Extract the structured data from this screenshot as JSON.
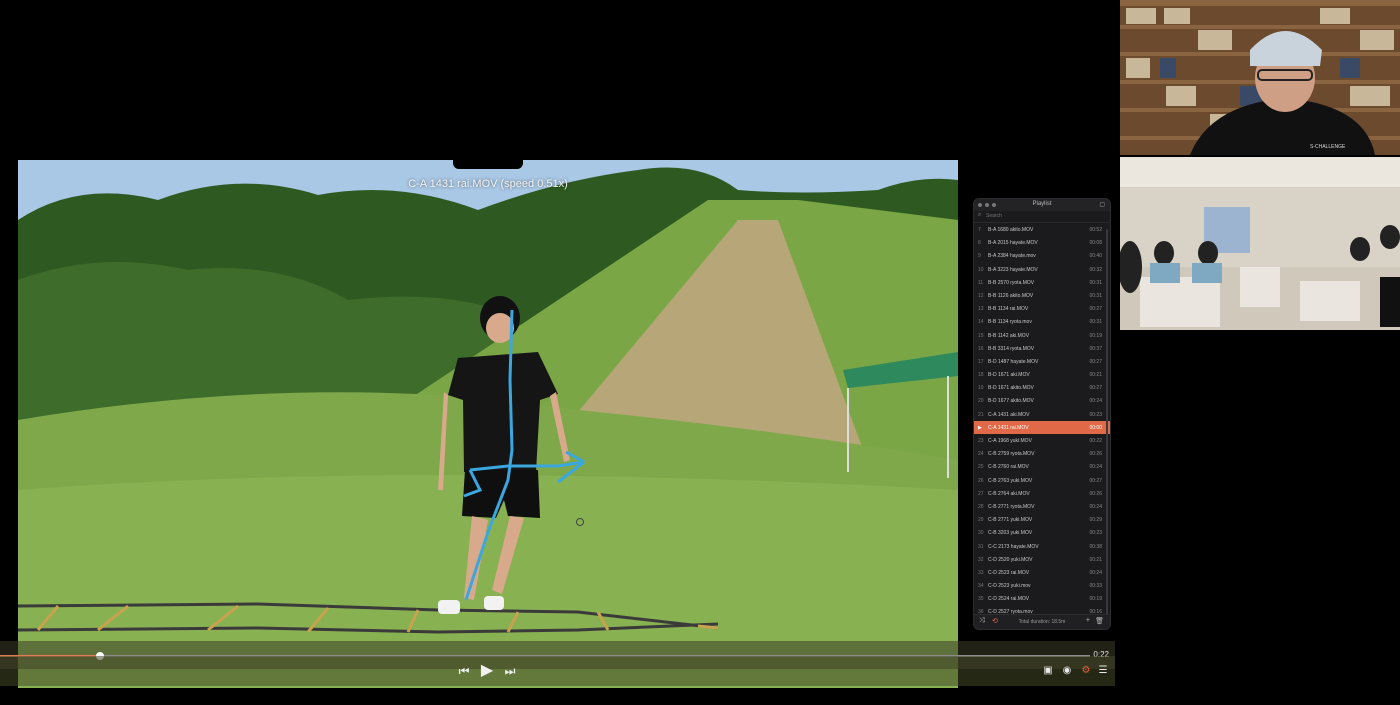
{
  "video": {
    "title": "C-A 1431 rai.MOV (speed 0.51x)",
    "progress_fraction": 0.092,
    "time": "0:22"
  },
  "controls": {
    "prev_icon": "skip-back-icon",
    "play_icon": "play-icon",
    "next_icon": "skip-forward-icon",
    "pip_icon": "picture-in-picture-icon",
    "audio_icon": "audio-icon",
    "settings_icon": "gear-icon",
    "playlist_icon": "list-icon"
  },
  "playlist": {
    "title": "Playlist",
    "search_placeholder": "Search",
    "total_duration": "Total duration: 18.5m",
    "items": [
      {
        "num": "7",
        "name": "B-A 1680 akito.MOV",
        "dur": "00:52",
        "active": false
      },
      {
        "num": "8",
        "name": "B-A 2015 hayate.MOV",
        "dur": "00:08",
        "active": false
      },
      {
        "num": "9",
        "name": "B-A 2384 hayate.mov",
        "dur": "00:40",
        "active": false
      },
      {
        "num": "10",
        "name": "B-A 3223 hayate.MOV",
        "dur": "00:32",
        "active": false
      },
      {
        "num": "11",
        "name": "B-B 2570 ryota.MOV",
        "dur": "00:31",
        "active": false
      },
      {
        "num": "12",
        "name": "B-B 1126 akito.MOV",
        "dur": "00:31",
        "active": false
      },
      {
        "num": "13",
        "name": "B-B 1134 rai.MOV",
        "dur": "00:27",
        "active": false
      },
      {
        "num": "14",
        "name": "B-B 1134 ryota.mov",
        "dur": "00:31",
        "active": false
      },
      {
        "num": "15",
        "name": "B-B 1142 aki.MOV",
        "dur": "00:19",
        "active": false
      },
      {
        "num": "16",
        "name": "B-B 3314 ryota.MOV",
        "dur": "00:37",
        "active": false
      },
      {
        "num": "17",
        "name": "B-D 1487 hayate.MOV",
        "dur": "00:27",
        "active": false
      },
      {
        "num": "18",
        "name": "B-D 1671 aki.MOV",
        "dur": "00:21",
        "active": false
      },
      {
        "num": "19",
        "name": "B-D 1671 akito.MOV",
        "dur": "00:27",
        "active": false
      },
      {
        "num": "20",
        "name": "B-D 1677 akito.MOV",
        "dur": "00:24",
        "active": false
      },
      {
        "num": "21",
        "name": "C-A 1431 aki.MOV",
        "dur": "00:23",
        "active": false
      },
      {
        "num": "",
        "name": "C-A 1431 rai.MOV",
        "dur": "00:00",
        "active": true
      },
      {
        "num": "23",
        "name": "C-A 1968 yuki.MOV",
        "dur": "00:22",
        "active": false
      },
      {
        "num": "24",
        "name": "C-B 2759 ryota.MOV",
        "dur": "00:26",
        "active": false
      },
      {
        "num": "25",
        "name": "C-B 2760 rai.MOV",
        "dur": "00:24",
        "active": false
      },
      {
        "num": "26",
        "name": "C-B 2763 yuki.MOV",
        "dur": "00:27",
        "active": false
      },
      {
        "num": "27",
        "name": "C-B 2764 aki.MOV",
        "dur": "00:26",
        "active": false
      },
      {
        "num": "28",
        "name": "C-B 2771 ryota.MOV",
        "dur": "00:24",
        "active": false
      },
      {
        "num": "29",
        "name": "C-B 2771 yuki.MOV",
        "dur": "00:29",
        "active": false
      },
      {
        "num": "30",
        "name": "C-B 3203 yuki.MOV",
        "dur": "00:23",
        "active": false
      },
      {
        "num": "31",
        "name": "C-C 2173 hayate.MOV",
        "dur": "00:38",
        "active": false
      },
      {
        "num": "32",
        "name": "C-D 2520 yuki.MOV",
        "dur": "00:21",
        "active": false
      },
      {
        "num": "33",
        "name": "C-D 2523 rai.MOV",
        "dur": "00:24",
        "active": false
      },
      {
        "num": "34",
        "name": "C-D 2523 yuki.mov",
        "dur": "00:33",
        "active": false
      },
      {
        "num": "35",
        "name": "C-D 2524 rai.MOV",
        "dur": "00:19",
        "active": false
      },
      {
        "num": "36",
        "name": "C-D 2527 ryota.mov",
        "dur": "00:16",
        "active": false
      }
    ],
    "footer_icons": [
      "shuffle-icon",
      "repeat-icon",
      "plus-icon",
      "trash-icon"
    ]
  },
  "webcams": {
    "host_badge": "S-CHALLENGE"
  },
  "colors": {
    "accent": "#e06a48",
    "annotation_line": "#3aa7e0"
  }
}
